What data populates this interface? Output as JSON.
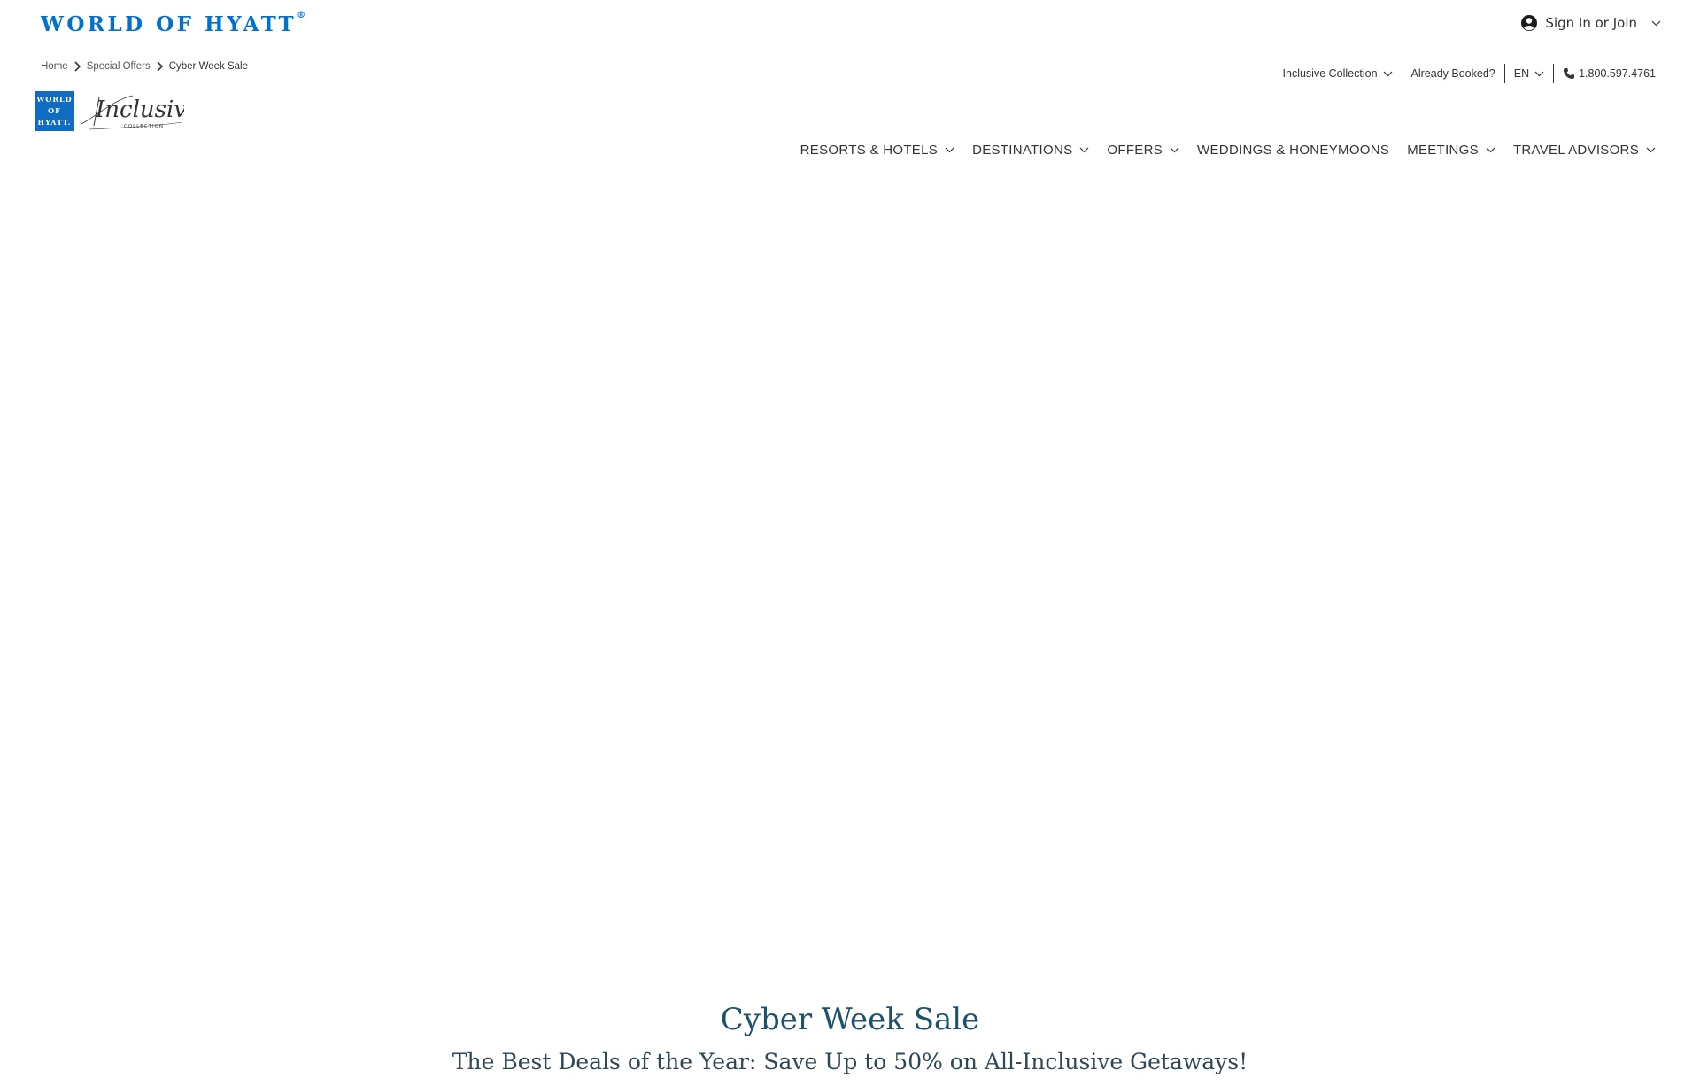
{
  "header": {
    "logo_text": "WORLD OF HYATT",
    "logo_mark": "®",
    "sign_in_label": "Sign In or Join"
  },
  "breadcrumb": {
    "items": [
      "Home",
      "Special Offers"
    ],
    "current": "Cyber Week Sale"
  },
  "utility_nav": {
    "collection_label": "Inclusive Collection",
    "already_booked": "Already Booked?",
    "language": "EN",
    "phone": "1.800.597.4761"
  },
  "brand": {
    "box_lines": [
      "WORLD",
      "OF",
      "HYATT."
    ],
    "script": "Inclusive",
    "sub": "COLLECTION"
  },
  "main_nav": {
    "items": [
      {
        "label": "RESORTS & HOTELS",
        "has_dropdown": true
      },
      {
        "label": "DESTINATIONS",
        "has_dropdown": true
      },
      {
        "label": "OFFERS",
        "has_dropdown": true
      },
      {
        "label": "WEDDINGS & HONEYMOONS",
        "has_dropdown": false
      },
      {
        "label": "MEETINGS",
        "has_dropdown": true
      },
      {
        "label": "TRAVEL ADVISORS",
        "has_dropdown": true
      }
    ]
  },
  "hero": {
    "title": "Cyber Week Sale",
    "subtitle": "The Best Deals of the Year: Save Up to 50% on All-Inclusive Getaways!"
  },
  "colors": {
    "brand_blue": "#0072ce",
    "hero_title": "#1d5269",
    "hero_subtitle": "#2f4755"
  }
}
